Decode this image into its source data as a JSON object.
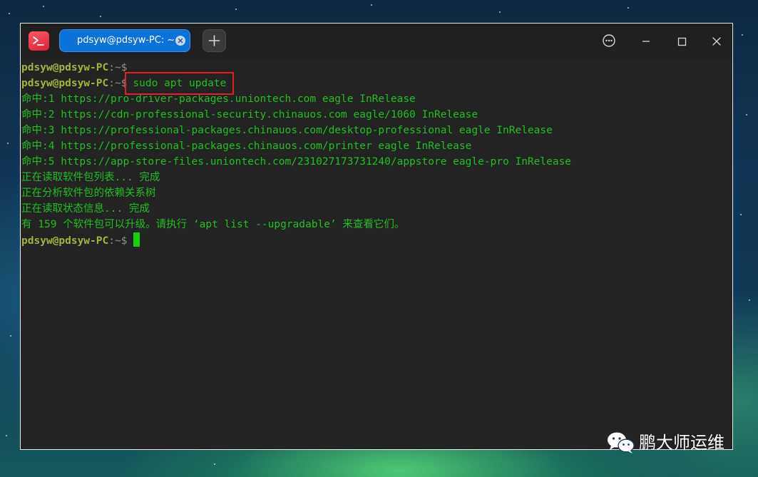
{
  "window": {
    "tab_title": "pdsyw@pdsyw-PC: ~"
  },
  "terminal": {
    "prompt_user": "pdsyw@pdsyw-PC",
    "prompt_sep": ":~$",
    "command": "sudo apt update",
    "output": [
      "命中:1 https://pro-driver-packages.uniontech.com eagle InRelease",
      "命中:2 https://cdn-professional-security.chinauos.com eagle/1060 InRelease",
      "命中:3 https://professional-packages.chinauos.com/desktop-professional eagle InRelease",
      "命中:4 https://professional-packages.chinauos.com/printer eagle InRelease",
      "命中:5 https://app-store-files.uniontech.com/231027173731240/appstore eagle-pro InRelease",
      "正在读取软件包列表... 完成",
      "正在分析软件包的依赖关系树",
      "正在读取状态信息... 完成",
      "有 159 个软件包可以升级。请执行 ‘apt list --upgradable’ 来查看它们。"
    ]
  },
  "watermark": {
    "text": "鹏大师运维",
    "icon": "wechat-icon"
  },
  "icons": {
    "app": "terminal-app-icon",
    "tab_close": "close-icon",
    "new_tab": "plus-icon",
    "menu": "more-icon",
    "minimize": "minimize-icon",
    "maximize": "maximize-icon",
    "close": "close-icon"
  },
  "colors": {
    "tab_accent": "#0a72d8",
    "prompt": "#a5b33b",
    "output": "#20c020",
    "highlight_box": "#e02222",
    "terminal_bg": "#232323"
  }
}
